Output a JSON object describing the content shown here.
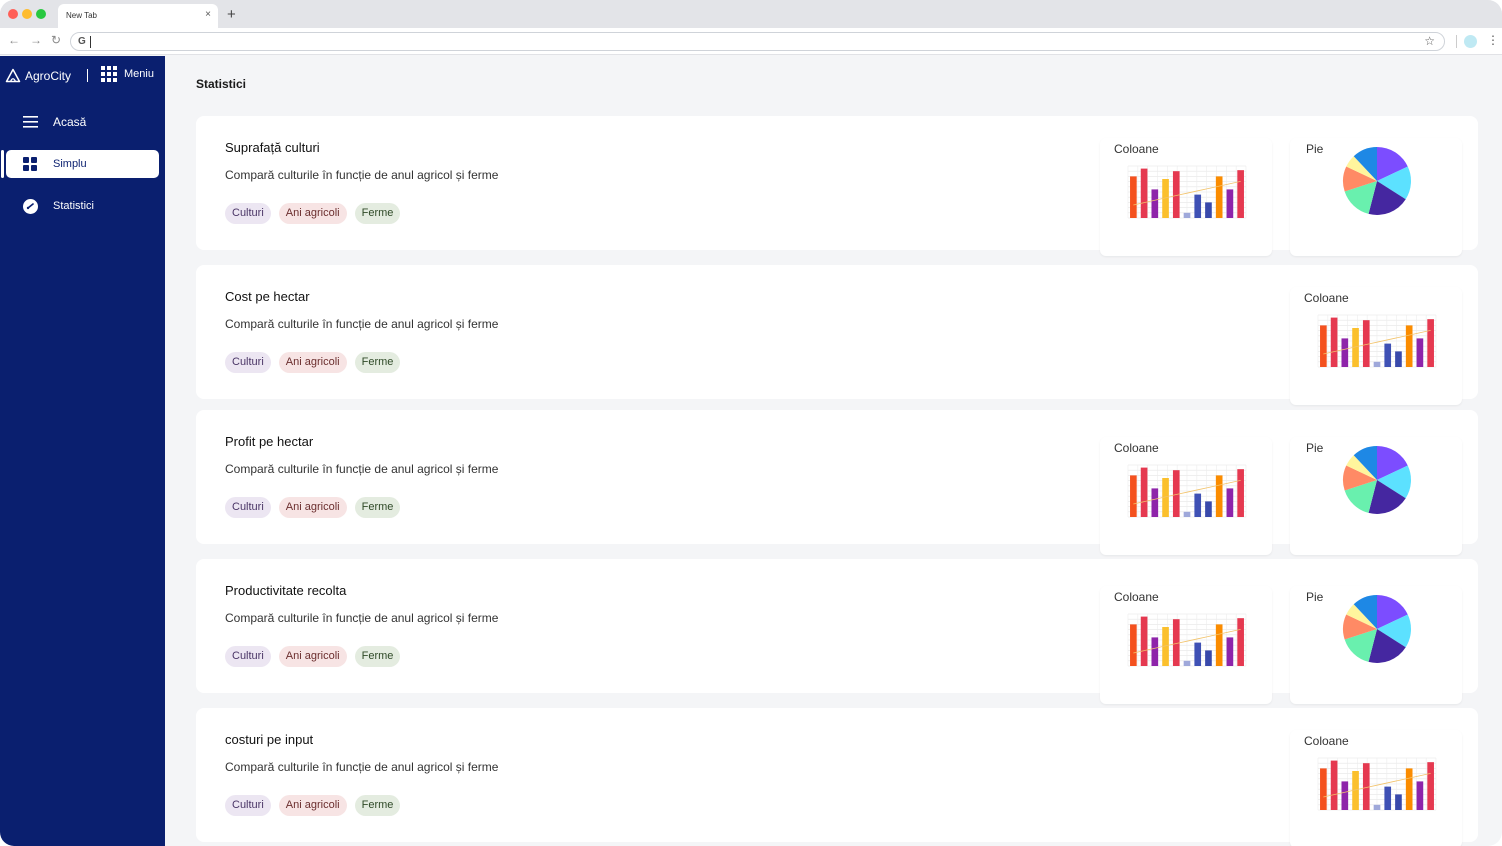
{
  "browser": {
    "tab_title": "New Tab",
    "tab_close": "×",
    "new_tab": "+",
    "address_prefix": "G"
  },
  "sidebar": {
    "brand": "AgroCity",
    "menu_label": "Meniu",
    "items": [
      {
        "label": "Acasă",
        "icon": "hamburger-icon"
      },
      {
        "label": "Simplu",
        "icon": "dashboard-grid-icon",
        "active": true
      },
      {
        "label": "Statistici",
        "icon": "gauge-icon"
      }
    ]
  },
  "main": {
    "title": "Statistici",
    "cards": [
      {
        "title": "Suprafață culturi",
        "description": "Compară culturile în funcție de anul agricol și ferme",
        "tags": [
          "Culturi",
          "Ani agricoli",
          "Ferme"
        ],
        "previews": [
          "Coloane",
          "Pie"
        ]
      },
      {
        "title": "Cost pe hectar",
        "description": "Compară culturile în funcție de anul agricol și ferme",
        "tags": [
          "Culturi",
          "Ani agricoli",
          "Ferme"
        ],
        "previews": [
          "Coloane"
        ]
      },
      {
        "title": "Profit pe hectar",
        "description": "Compară culturile în funcție de anul agricol și ferme",
        "tags": [
          "Culturi",
          "Ani agricoli",
          "Ferme"
        ],
        "previews": [
          "Coloane",
          "Pie"
        ]
      },
      {
        "title": "Productivitate recolta",
        "description": "Compară culturile în funcție de anul agricol și ferme",
        "tags": [
          "Culturi",
          "Ani agricoli",
          "Ferme"
        ],
        "previews": [
          "Coloane",
          "Pie"
        ]
      },
      {
        "title": "costuri pe input",
        "description": "Compară culturile în funcție de anul agricol și ferme",
        "tags": [
          "Culturi",
          "Ani agricoli",
          "Ferme"
        ],
        "previews": [
          "Coloane"
        ]
      }
    ]
  },
  "colors": {
    "sidebar_bg": "#0a1f6f",
    "tag_culturi": "#ece6f2",
    "tag_ani": "#f7e4e4",
    "tag_ferme": "#e4ece0"
  },
  "thumbnail": {
    "bar_values": [
      0.8,
      0.95,
      0.55,
      0.75,
      0.9,
      0.1,
      0.45,
      0.3,
      0.8,
      0.55,
      0.92
    ],
    "bar_colors": [
      "#f4511e",
      "#e53950",
      "#8e24aa",
      "#fbc02d",
      "#e53950",
      "#9fa8da",
      "#3f51b5",
      "#3949ab",
      "#fb8c00",
      "#8e24aa",
      "#e53950"
    ],
    "pie_slices": [
      {
        "value": 18,
        "color": "#7c4dff"
      },
      {
        "value": 16,
        "color": "#5ce1ff"
      },
      {
        "value": 20,
        "color": "#4527a0"
      },
      {
        "value": 16,
        "color": "#69f0ae"
      },
      {
        "value": 12,
        "color": "#ff8a65"
      },
      {
        "value": 6,
        "color": "#fff59d"
      },
      {
        "value": 12,
        "color": "#1e88e5"
      }
    ]
  }
}
